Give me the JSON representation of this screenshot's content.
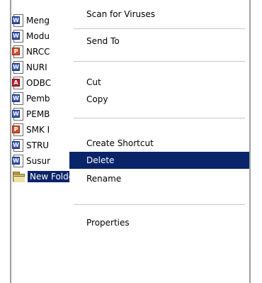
{
  "files": [
    {
      "name": "Meng",
      "type": "word"
    },
    {
      "name": "Modu",
      "type": "word"
    },
    {
      "name": "NRCC",
      "type": "ppt"
    },
    {
      "name": "NURI",
      "type": "word"
    },
    {
      "name": "ODBC",
      "type": "pdf"
    },
    {
      "name": "Pemb",
      "type": "word"
    },
    {
      "name": "PEMB",
      "type": "word"
    },
    {
      "name": "SMK I",
      "type": "ppt"
    },
    {
      "name": "STRU",
      "type": "word"
    },
    {
      "name": "Susur",
      "type": "word"
    }
  ],
  "new_folder": {
    "name": "New Folder"
  },
  "context_menu": {
    "scan": "Scan for Viruses",
    "send_to": "Send To",
    "cut": "Cut",
    "copy": "Copy",
    "create_shortcut": "Create Shortcut",
    "delete": "Delete",
    "rename": "Rename",
    "properties": "Properties",
    "highlighted": "Delete"
  },
  "colors": {
    "selection": "#0a246a",
    "word_badge": "#2e52b8",
    "ppt_badge": "#d1512d",
    "pdf_badge": "#b51f2e"
  }
}
